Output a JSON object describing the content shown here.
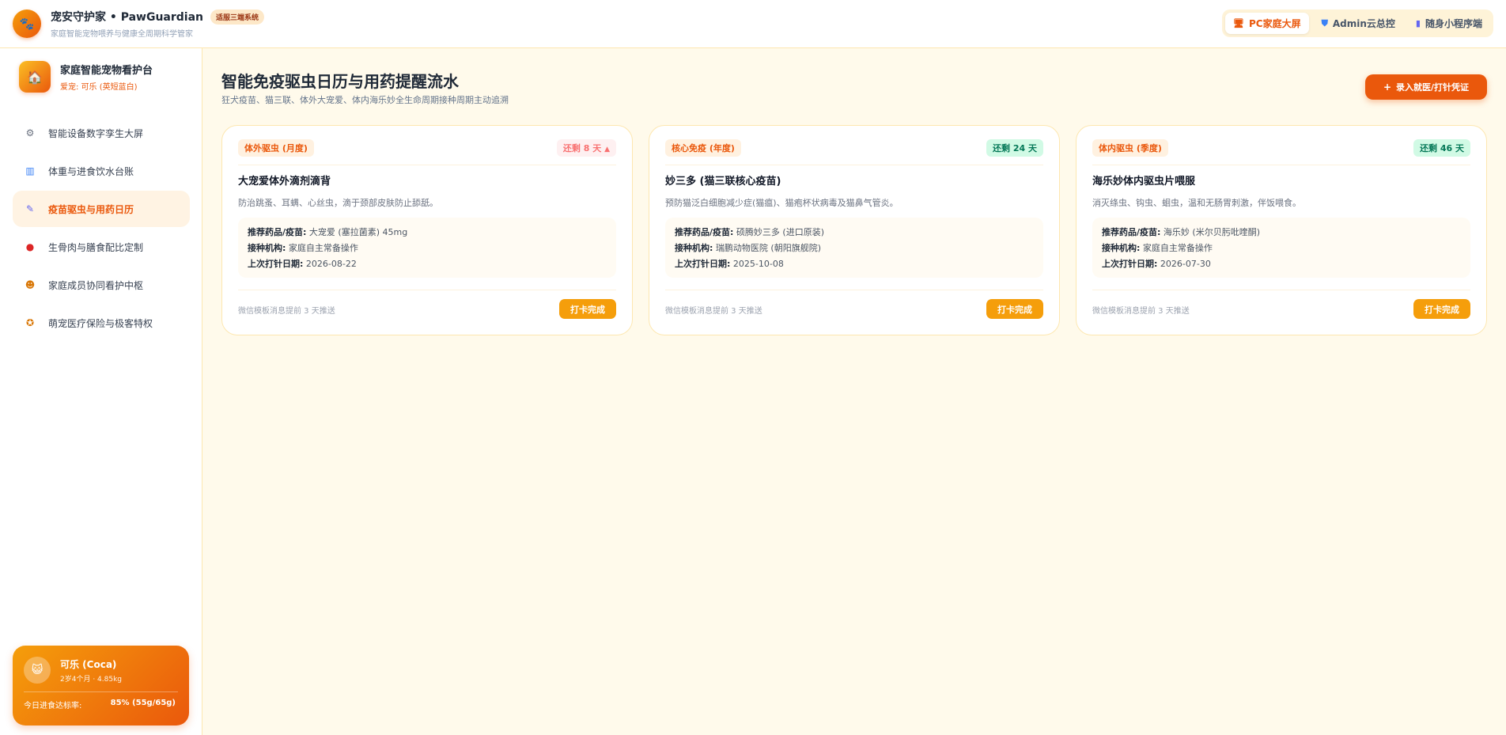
{
  "header": {
    "logo_icon": "paw-icon",
    "title": "宠安守护家 • PawGuardian",
    "badge": "适服三端系统",
    "subtitle": "家庭智能宠物喂养与健康全周期科学管家",
    "views": [
      {
        "label": "PC家庭大屏",
        "icon": "monitor-icon",
        "active": true
      },
      {
        "label": "Admin云总控",
        "icon": "shield-icon",
        "active": false
      },
      {
        "label": "随身小程序端",
        "icon": "phone-icon",
        "active": false
      }
    ]
  },
  "sidebar": {
    "hub_title": "家庭智能宠物看护台",
    "hub_pet": "爱宠: 可乐 (英短蓝白)",
    "items": [
      {
        "label": "智能设备数字孪生大屏",
        "icon": "device-icon",
        "active": false
      },
      {
        "label": "体重与进食饮水台账",
        "icon": "bar-chart-icon",
        "active": false
      },
      {
        "label": "疫苗驱虫与用药日历",
        "icon": "syringe-icon",
        "active": true
      },
      {
        "label": "生骨肉与膳食配比定制",
        "icon": "meat-icon",
        "active": false
      },
      {
        "label": "家庭成员协同看护中枢",
        "icon": "family-icon",
        "active": false
      },
      {
        "label": "萌宠医疗保险与极客特权",
        "icon": "medal-icon",
        "active": false
      }
    ],
    "pet_card": {
      "name": "可乐 (Coca)",
      "meta": "2岁4个月 · 4.85kg",
      "stat_label": "今日进食达标率:",
      "stat_value": "85% (55g/65g)"
    }
  },
  "main": {
    "title": "智能免疫驱虫日历与用药提醒流水",
    "subtitle": "狂犬疫苗、猫三联、体外大宠爱、体内海乐妙全生命周期接种周期主动追溯",
    "primary_button": "录入就医/打针凭证",
    "labels": {
      "drug": "推荐药品/疫苗:",
      "org": "接种机构:",
      "date": "上次打针日期:"
    },
    "cards": [
      {
        "tag": "体外驱虫 (月度)",
        "countdown": "还剩 8 天",
        "countdown_state": "urgent",
        "name": "大宠爱体外滴剂滴背",
        "desc": "防治跳蚤、耳螨、心丝虫，滴于颈部皮肤防止舔舐。",
        "drug": "大宠爱 (塞拉菌素) 45mg",
        "org": "家庭自主常备操作",
        "date": "2026-08-22",
        "note": "微信模板消息提前 3 天推送",
        "button": "打卡完成"
      },
      {
        "tag": "核心免疫 (年度)",
        "countdown": "还剩 24 天",
        "countdown_state": "ok",
        "name": "妙三多 (猫三联核心疫苗)",
        "desc": "预防猫泛白细胞减少症(猫瘟)、猫疱杯状病毒及猫鼻气管炎。",
        "drug": "硕腾妙三多 (进口原装)",
        "org": "瑞鹏动物医院 (朝阳旗舰院)",
        "date": "2025-10-08",
        "note": "微信模板消息提前 3 天推送",
        "button": "打卡完成"
      },
      {
        "tag": "体内驱虫 (季度)",
        "countdown": "还剩 46 天",
        "countdown_state": "ok",
        "name": "海乐妙体内驱虫片喂服",
        "desc": "消灭绦虫、钩虫、蛔虫，温和无肠胃刺激，伴饭喂食。",
        "drug": "海乐妙 (米尔贝肟吡喹酮)",
        "org": "家庭自主常备操作",
        "date": "2026-07-30",
        "note": "微信模板消息提前 3 天推送",
        "button": "打卡完成"
      }
    ]
  },
  "colors": {
    "accent": "#ea580c",
    "accent_light": "#f59e0b",
    "background": "#fffaeb",
    "urgent": "#f87171",
    "ok": "#047857"
  }
}
